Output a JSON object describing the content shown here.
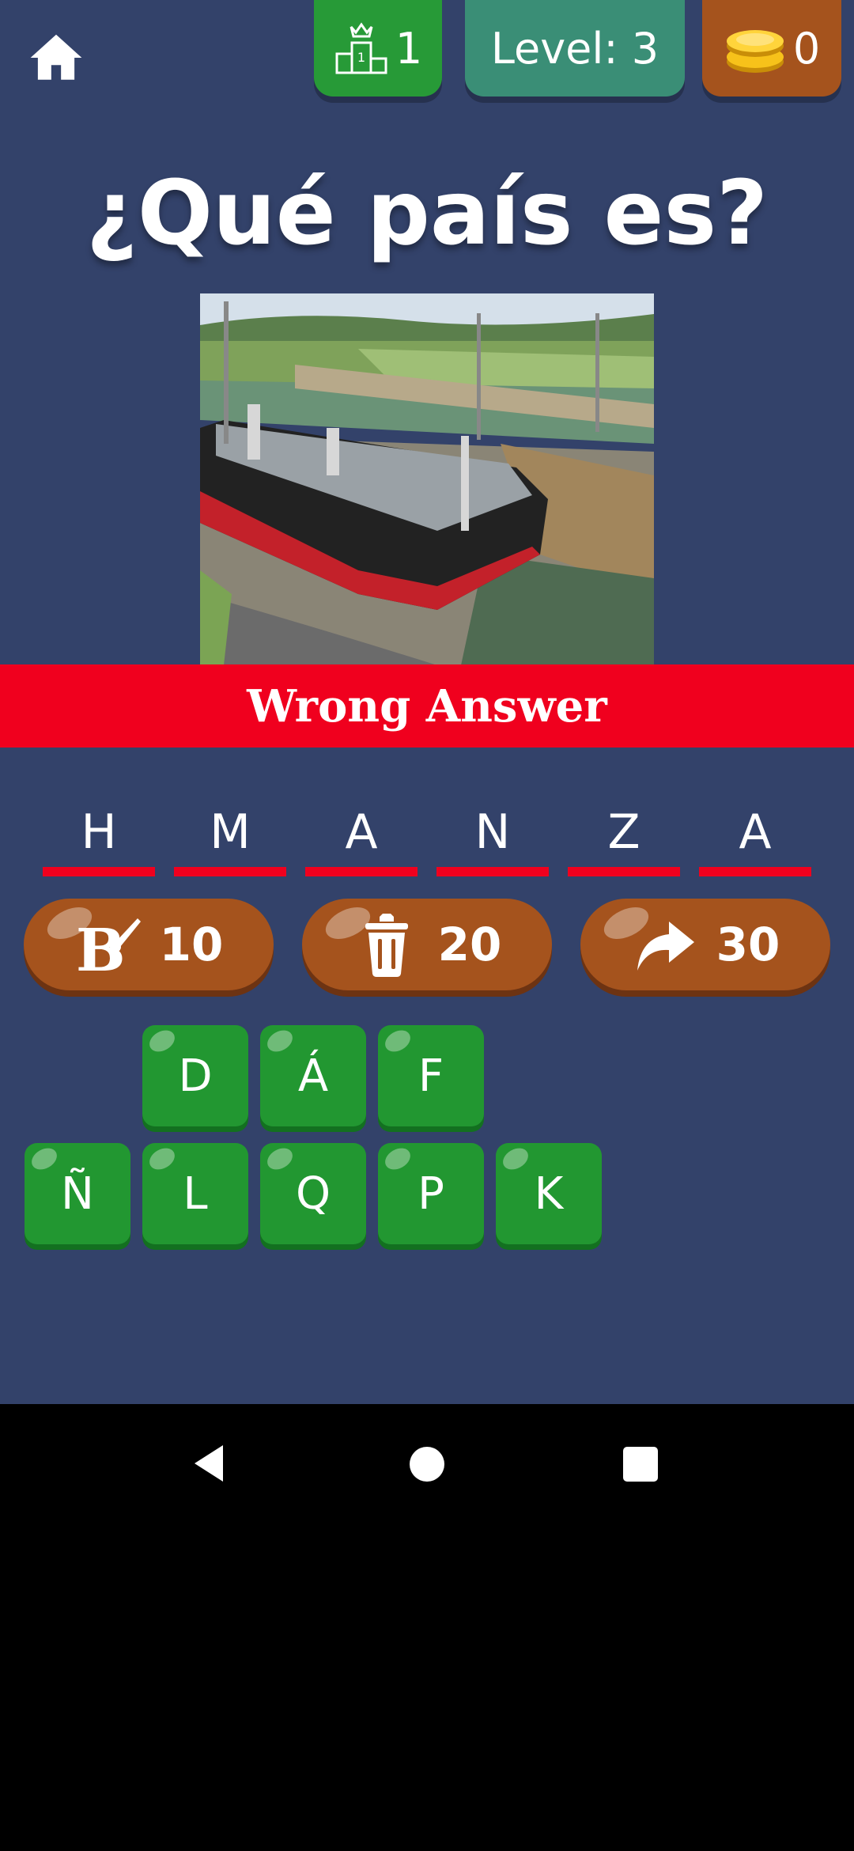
{
  "header": {
    "rank_value": "1",
    "level_label": "Level: 3",
    "coins_value": "0"
  },
  "question": {
    "title": "¿Qué país es?"
  },
  "feedback": {
    "message": "Wrong Answer"
  },
  "answer_letters": [
    "H",
    "M",
    "A",
    "N",
    "Z",
    "A"
  ],
  "powerups": [
    {
      "icon": "paint-brush-icon",
      "cost": "10"
    },
    {
      "icon": "trash-can-icon",
      "cost": "20"
    },
    {
      "icon": "skip-arrow-icon",
      "cost": "30"
    }
  ],
  "keyboard": {
    "row1": [
      "D",
      "Á",
      "F"
    ],
    "row2": [
      "Ñ",
      "L",
      "Q",
      "P",
      "K"
    ]
  },
  "colors": {
    "background": "#33426a",
    "banner_red": "#f0001e",
    "key_green": "#229731",
    "powerup_brown": "#a5531d",
    "level_teal": "#3a8e76"
  }
}
